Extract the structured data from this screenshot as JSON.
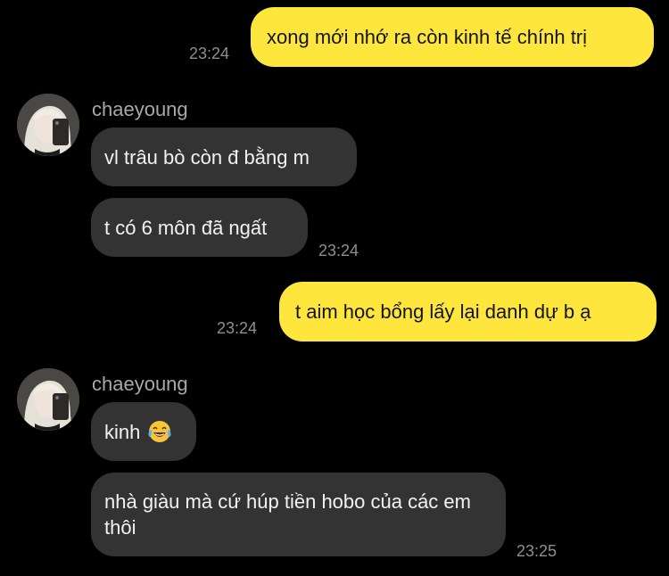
{
  "messages": [
    {
      "side": "out",
      "text": "xong mới nhớ ra còn kinh tế chính trị",
      "time": "23:24"
    },
    {
      "side": "in",
      "sender": "chaeyoung",
      "texts": [
        "vl trâu bò còn đ bằng m",
        "t có 6 môn đã ngất"
      ],
      "time": "23:24"
    },
    {
      "side": "out",
      "text": "t aim học bổng lấy lại danh dự b ạ",
      "time": "23:24"
    },
    {
      "side": "in",
      "sender": "chaeyoung",
      "texts": [
        "kinh",
        "nhà giàu mà cứ húp tiền hobo của các em thôi"
      ],
      "emoji": "laughing-tears-emoji",
      "time": "23:25"
    }
  ],
  "colors": {
    "background": "#000000",
    "outgoing_bubble": "#fee63c",
    "incoming_bubble": "#333333",
    "timestamp": "#8e8e8e",
    "sender_name": "#a8a8a8"
  }
}
